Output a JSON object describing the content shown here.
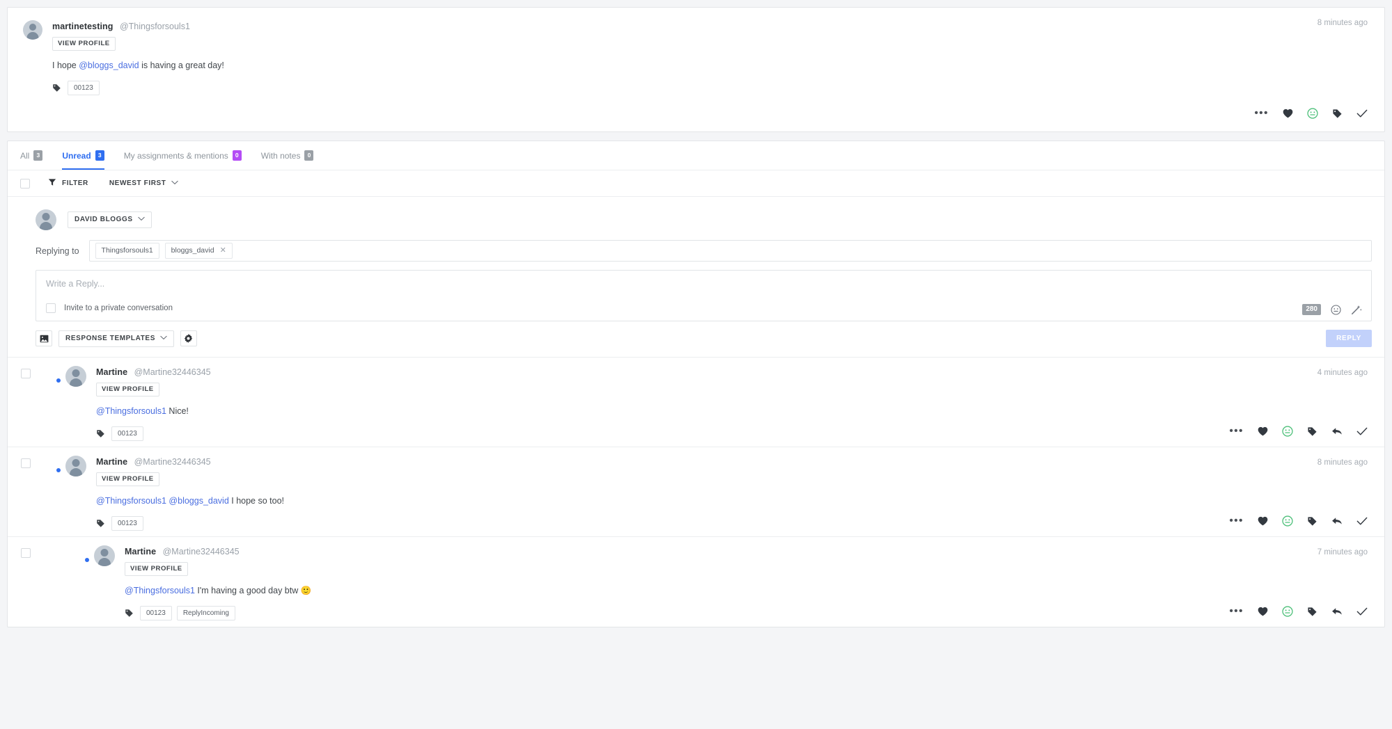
{
  "parent_post": {
    "author_name": "martinetesting",
    "author_handle": "@Thingsforsouls1",
    "view_profile_label": "VIEW PROFILE",
    "text_before": "I hope ",
    "mention": "@bloggs_david",
    "text_after": " is having a great day!",
    "tags": [
      "00123"
    ],
    "timestamp": "8 minutes ago",
    "actions": [
      "more-icon",
      "heart-icon",
      "smiley-icon",
      "tag-icon",
      "check-icon"
    ]
  },
  "tabs": [
    {
      "label": "All",
      "count": "3",
      "badge_color": "#9aa0a6",
      "active": false
    },
    {
      "label": "Unread",
      "count": "3",
      "badge_color": "#2f6ef0",
      "active": true
    },
    {
      "label": "My assignments & mentions",
      "count": "0",
      "badge_color": "#b44cf5",
      "active": false
    },
    {
      "label": "With notes",
      "count": "0",
      "badge_color": "#9aa0a6",
      "active": false
    }
  ],
  "filterbar": {
    "filter_label": "FILTER",
    "sort_label": "NEWEST FIRST"
  },
  "composer": {
    "account_label": "DAVID BLOGGS",
    "replying_to_label": "Replying to",
    "recipients": [
      {
        "name": "Thingsforsouls1",
        "removable": false
      },
      {
        "name": "bloggs_david",
        "removable": true
      }
    ],
    "placeholder": "Write a Reply...",
    "invite_label": "Invite to a private conversation",
    "char_counter": "280",
    "image_icon": "image-icon",
    "templates_label": "RESPONSE TEMPLATES",
    "settings_icon": "gear-icon",
    "reply_button": "REPLY",
    "reply_button_color": "#c2d1fb"
  },
  "messages": [
    {
      "author_name": "Martine",
      "author_handle": "@Martine32446345",
      "view_profile_label": "VIEW PROFILE",
      "mention1": "@Thingsforsouls1",
      "mention2": "",
      "text": " Nice!",
      "tags": [
        "00123"
      ],
      "timestamp": "4 minutes ago",
      "indent": 0,
      "unread": true
    },
    {
      "author_name": "Martine",
      "author_handle": "@Martine32446345",
      "view_profile_label": "VIEW PROFILE",
      "mention1": "@Thingsforsouls1",
      "mention2": "@bloggs_david",
      "text": " I hope so too!",
      "tags": [
        "00123"
      ],
      "timestamp": "8 minutes ago",
      "indent": 0,
      "unread": true
    },
    {
      "author_name": "Martine",
      "author_handle": "@Martine32446345",
      "view_profile_label": "VIEW PROFILE",
      "mention1": "@Thingsforsouls1",
      "mention2": "",
      "text": " I'm having a good day btw 🙂",
      "tags": [
        "00123",
        "ReplyIncoming"
      ],
      "timestamp": "7 minutes ago",
      "indent": 41,
      "unread": true
    }
  ],
  "colors": {
    "accent": "#2f6ef0",
    "mention": "#4a6ee0",
    "page_bg": "#f4f5f7",
    "card_bg": "#ffffff",
    "border": "#e3e5e8",
    "smiley_green": "#4ec07a"
  }
}
